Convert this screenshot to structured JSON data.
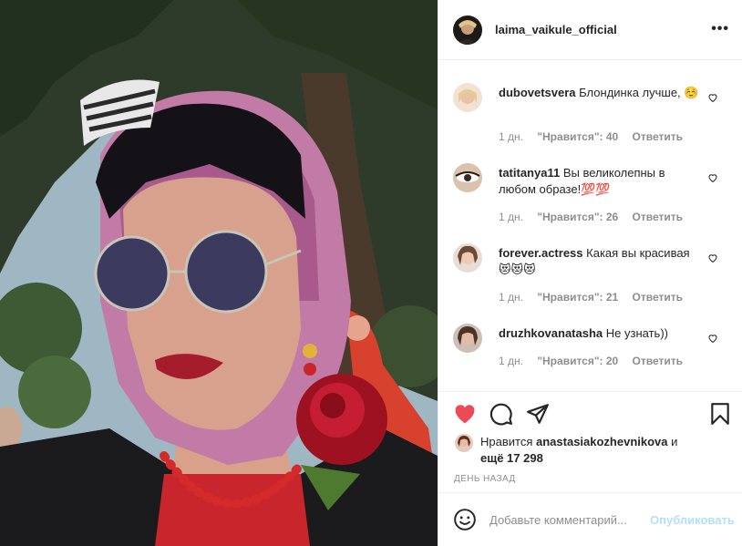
{
  "post": {
    "username": "laima_vaikule_official",
    "more_label": "•••"
  },
  "comments": [
    {
      "user": "dubovetsvera",
      "text": "Блондинка лучше, ☺️",
      "age": "1 дн.",
      "likes": "\"Нравится\": 40",
      "reply": "Ответить"
    },
    {
      "user": "tatitanya11",
      "text": "Вы великолепны в любом образе!💯💯",
      "age": "1 дн.",
      "likes": "\"Нравится\": 26",
      "reply": "Ответить"
    },
    {
      "user": "forever.actress",
      "text": "Какая вы красивая😻😻😻",
      "age": "1 дн.",
      "likes": "\"Нравится\": 21",
      "reply": "Ответить"
    },
    {
      "user": "druzhkovanatasha",
      "text": "Не узнать))",
      "age": "1 дн.",
      "likes": "\"Нравится\": 20",
      "reply": "Ответить"
    }
  ],
  "likes": {
    "prefix": "Нравится",
    "user": "anastasiakozhevnikova",
    "and": "и",
    "more": "ещё 17 298"
  },
  "time_label": "ДЕНЬ НАЗАД",
  "add_comment": {
    "placeholder": "Добавьте комментарий...",
    "publish_label": "Опубликовать"
  },
  "colors": {
    "like_red": "#ed4956",
    "publish_blue": "#b2dffc",
    "muted": "#8e8e8e"
  },
  "icons": [
    "more-icon",
    "heart-icon",
    "comment-icon",
    "share-icon",
    "bookmark-icon",
    "smile-icon"
  ]
}
